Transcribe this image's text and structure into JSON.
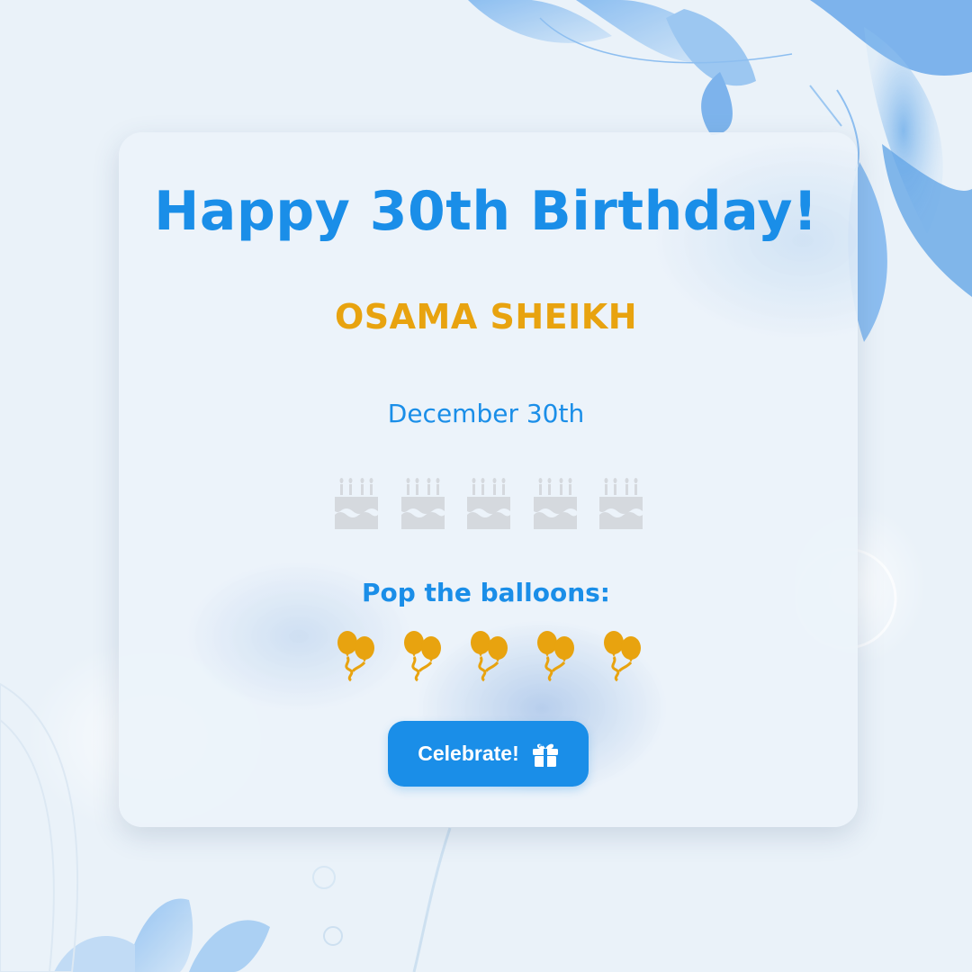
{
  "greeting": {
    "title": "Happy 30th Birthday!",
    "name": "OSAMA SHEIKH",
    "date": "December 30th"
  },
  "cakes": [
    {
      "icon": "birthday-cake-icon"
    },
    {
      "icon": "birthday-cake-icon"
    },
    {
      "icon": "birthday-cake-icon"
    },
    {
      "icon": "birthday-cake-icon"
    },
    {
      "icon": "birthday-cake-icon"
    }
  ],
  "balloons": {
    "label": "Pop the balloons:",
    "items": [
      {
        "icon": "balloons-icon"
      },
      {
        "icon": "balloons-icon"
      },
      {
        "icon": "balloons-icon"
      },
      {
        "icon": "balloons-icon"
      },
      {
        "icon": "balloons-icon"
      }
    ]
  },
  "action": {
    "celebrate_label": "Celebrate!",
    "icon": "gift-icon"
  },
  "colors": {
    "accent_blue": "#1a8ee8",
    "accent_gold": "#e8a30f",
    "cake_gray": "#d5d9de",
    "background": "#eaf2f9"
  }
}
